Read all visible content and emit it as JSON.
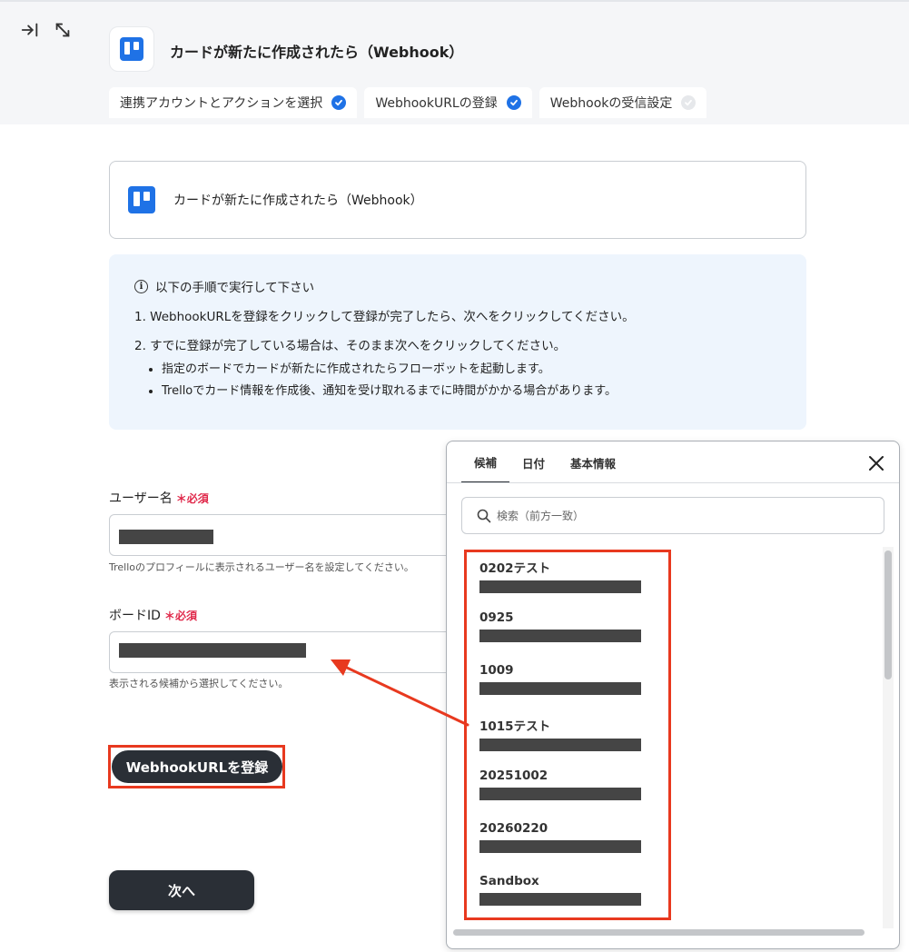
{
  "header": {
    "title": "カードが新たに作成されたら（Webhook）",
    "tabs": [
      {
        "label": "連携アカウントとアクションを選択",
        "done": true
      },
      {
        "label": "WebhookURLの登録",
        "done": true
      },
      {
        "label": "Webhookの受信設定",
        "done": false
      }
    ]
  },
  "app_card": {
    "title": "カードが新たに作成されたら（Webhook）"
  },
  "info": {
    "heading": "以下の手順で実行して下さい",
    "step1": "1. WebhookURLを登録をクリックして登録が完了したら、次へをクリックしてください。",
    "step2": "2. すでに登録が完了している場合は、そのまま次へをクリックしてください。",
    "bullets": [
      "指定のボードでカードが新たに作成されたらフローボットを起動します。",
      "Trelloでカード情報を作成後、通知を受け取れるまでに時間がかかる場合があります。"
    ]
  },
  "form": {
    "username_label": "ユーザー名",
    "username_hint": "Trelloのプロフィールに表示されるユーザー名を設定してください。",
    "board_label": "ボードID",
    "board_hint": "表示される候補から選択してください。",
    "required": "必須"
  },
  "buttons": {
    "register": "WebhookURLを登録",
    "next": "次へ"
  },
  "popup": {
    "tabs": [
      "候補",
      "日付",
      "基本情報"
    ],
    "search_placeholder": "検索（前方一致）",
    "candidates": [
      "0202テスト",
      "0925",
      "1009",
      "1015テスト",
      "20251002",
      "20260220",
      "Sandbox"
    ]
  },
  "colors": {
    "accent": "#1f72e6",
    "highlight": "#e8391f",
    "button_dark": "#2a2f36",
    "required": "#e0284a"
  }
}
